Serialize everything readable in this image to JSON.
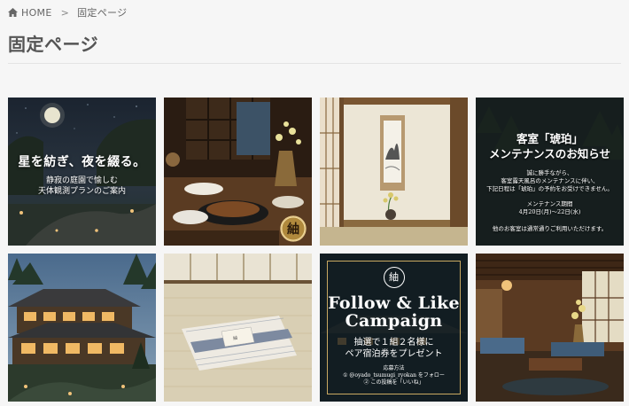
{
  "breadcrumb": {
    "home": "HOME",
    "separator": ">",
    "current": "固定ページ"
  },
  "page_title": "固定ページ",
  "posts": [
    {
      "heading": "星を紡ぎ、夜を綴る。",
      "sub1": "静寂の庭園で愉しむ",
      "sub2": "天体観測プランのご案内"
    },
    {
      "seal": "紬"
    },
    {
      "scroll": ""
    },
    {
      "head1": "客室「琥珀」",
      "head2": "メンテナンスのお知らせ",
      "body1": "誠に勝手ながら、",
      "body2": "客室露天風呂のメンテナンスに伴い、",
      "body3": "下記日程は「琥珀」の予約をお受けできません。",
      "period_label": "メンテナンス期間",
      "period_dates": "4月20日(月)〜22日(水)",
      "footer": "他のお客室は通常通りご利用いただけます。"
    },
    {},
    {
      "tag": "紬"
    },
    {
      "logo": "紬",
      "head1": "Follow & Like",
      "head2": "Campaign",
      "sub1": "抽選で１組２名様に",
      "sub2": "ペア宿泊券をプレゼント",
      "apply_label": "応募方法",
      "step1": "① @oyado_tsumugi_ryokan をフォロー",
      "step2": "② この投稿を「いいね」"
    },
    {}
  ],
  "colors": {
    "background": "#f6f6f6",
    "accent_gold": "#c9a961"
  }
}
